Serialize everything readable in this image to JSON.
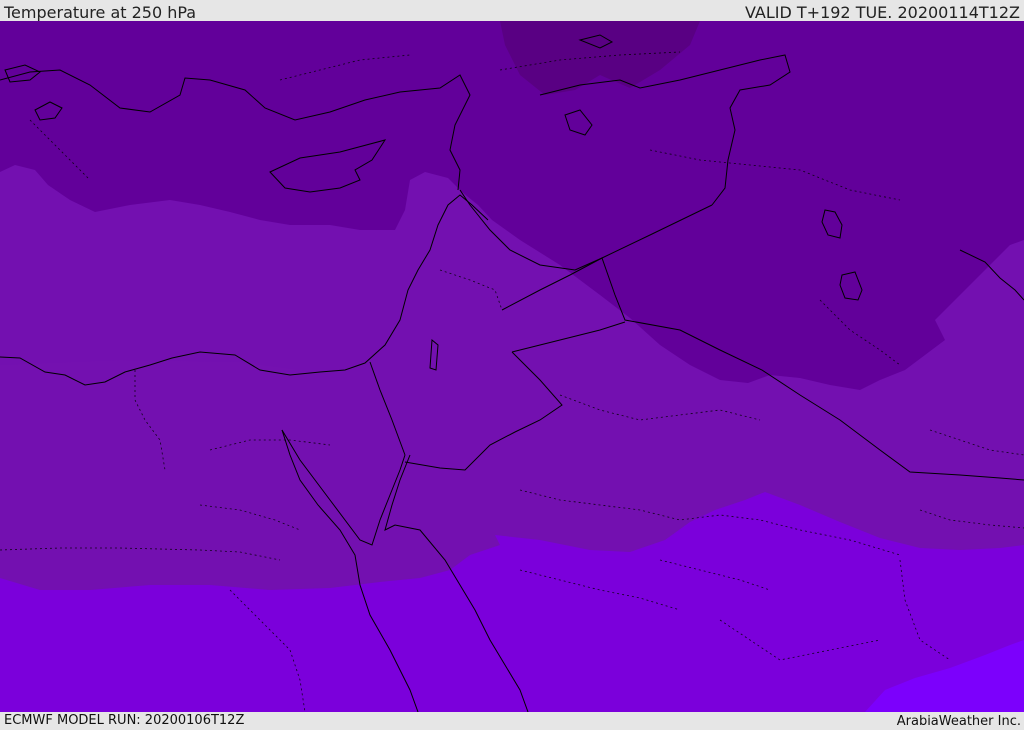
{
  "header": {
    "title": "Temperature at 250 hPa",
    "valid": "VALID T+192 TUE. 20200114T12Z"
  },
  "footer": {
    "model_run": "ECMWF MODEL RUN: 20200106T12Z",
    "credit": "ArabiaWeather Inc."
  },
  "map": {
    "variable": "temperature",
    "level": "250 hPa",
    "palette": {
      "darkest": "#590083",
      "dark": "#62009a",
      "mid": "#7310b0",
      "light": "#7b00db",
      "lightest": "#7c00fc"
    },
    "coastline_color": "#000000",
    "border_style": "dotted"
  }
}
